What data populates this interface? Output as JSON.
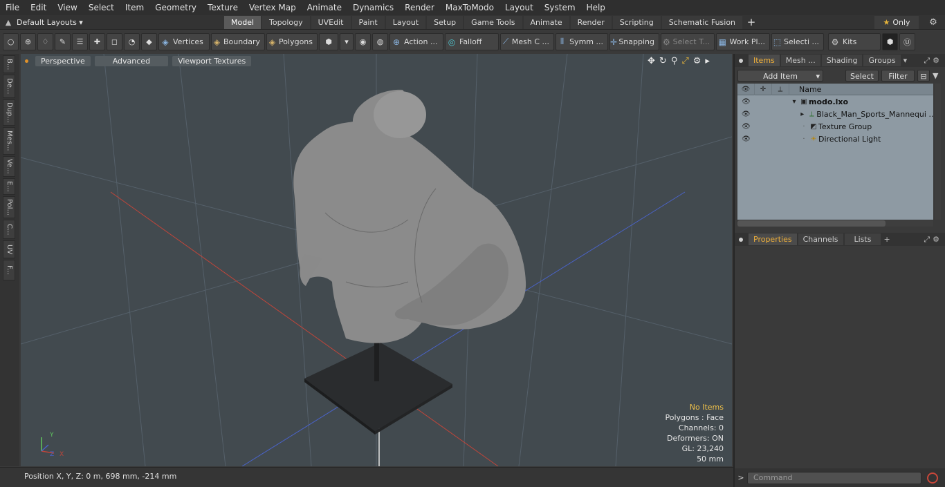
{
  "menu": [
    "File",
    "Edit",
    "View",
    "Select",
    "Item",
    "Geometry",
    "Texture",
    "Vertex Map",
    "Animate",
    "Dynamics",
    "Render",
    "MaxToModo",
    "Layout",
    "System",
    "Help"
  ],
  "layout_selector": "Default Layouts ▾",
  "layout_tabs": [
    {
      "label": "Model",
      "active": true
    },
    {
      "label": "Topology",
      "active": false
    },
    {
      "label": "UVEdit",
      "active": false
    },
    {
      "label": "Paint",
      "active": false
    },
    {
      "label": "Layout",
      "active": false
    },
    {
      "label": "Setup",
      "active": false
    },
    {
      "label": "Game Tools",
      "active": false
    },
    {
      "label": "Animate",
      "active": false
    },
    {
      "label": "Render",
      "active": false
    },
    {
      "label": "Scripting",
      "active": false
    },
    {
      "label": "Schematic Fusion",
      "active": false
    }
  ],
  "only_label": "Only",
  "toolbar": {
    "vertices": "Vertices",
    "boundary": "Boundary",
    "polygons": "Polygons",
    "action": "Action ...",
    "falloff": "Falloff",
    "mesh": "Mesh C ...",
    "symm": "Symm ...",
    "snapping": "Snapping",
    "select_t": "Select T...",
    "work_pl": "Work Pl...",
    "selecti": "Selecti ...",
    "kits": "Kits"
  },
  "left_tabs": [
    "B...",
    "De...",
    "Dup...",
    "Mes...",
    "Ve...",
    "E...",
    "Pol...",
    "C...",
    "UV",
    "F..."
  ],
  "viewport": {
    "buttons": [
      "Perspective",
      "Advanced",
      "Viewport Textures"
    ],
    "info": {
      "no_items": "No Items",
      "polygons": "Polygons : Face",
      "channels": "Channels: 0",
      "deformers": "Deformers: ON",
      "gl": "GL: 23,240",
      "focal": "50 mm"
    },
    "axis": {
      "y": "Y",
      "x": "X",
      "z": "Z"
    }
  },
  "status": "Position X, Y, Z:  0 m, 698 mm, -214 mm",
  "items_panel": {
    "tabs": [
      {
        "label": "Items",
        "active": true
      },
      {
        "label": "Mesh ...",
        "active": false
      },
      {
        "label": "Shading",
        "active": false
      },
      {
        "label": "Groups",
        "active": false
      }
    ],
    "add_item": "Add Item",
    "select": "Select",
    "filter": "Filter",
    "column_name": "Name",
    "tree": [
      {
        "label": "modo.lxo",
        "bold": true
      },
      {
        "label": "Black_Man_Sports_Mannequi ...",
        "bold": false
      },
      {
        "label": "Texture Group",
        "bold": false
      },
      {
        "label": "Directional Light",
        "bold": false
      }
    ]
  },
  "properties_panel": {
    "tabs": [
      {
        "label": "Properties",
        "active": true
      },
      {
        "label": "Channels",
        "active": false
      },
      {
        "label": "Lists",
        "active": false
      }
    ]
  },
  "command_placeholder": "Command",
  "colors": {
    "accent": "#f0b03a",
    "viewport_bg": "#424a4f",
    "red_axis": "#c0453a",
    "blue_axis": "#4a63c8"
  }
}
